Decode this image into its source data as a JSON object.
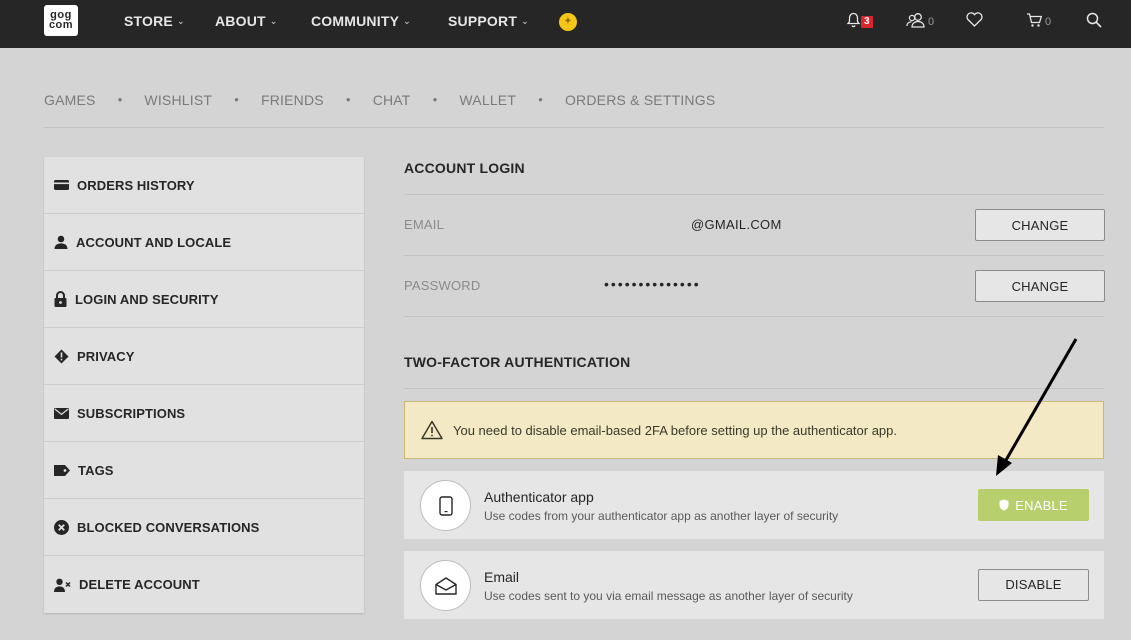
{
  "topbar": {
    "logo_line1": "gog",
    "logo_line2": "com",
    "nav": [
      {
        "label": "STORE"
      },
      {
        "label": "ABOUT"
      },
      {
        "label": "COMMUNITY"
      },
      {
        "label": "SUPPORT"
      }
    ],
    "notifications_count": "3",
    "friends_count": "0",
    "cart_count": "0"
  },
  "subnav": [
    "GAMES",
    "WISHLIST",
    "FRIENDS",
    "CHAT",
    "WALLET",
    "ORDERS & SETTINGS"
  ],
  "sidebar": [
    {
      "label": "ORDERS HISTORY",
      "icon": "card-icon"
    },
    {
      "label": "ACCOUNT AND LOCALE",
      "icon": "user-icon"
    },
    {
      "label": "LOGIN AND SECURITY",
      "icon": "lock-icon"
    },
    {
      "label": "PRIVACY",
      "icon": "privacy-icon"
    },
    {
      "label": "SUBSCRIPTIONS",
      "icon": "envelope-icon"
    },
    {
      "label": "TAGS",
      "icon": "tag-icon"
    },
    {
      "label": "BLOCKED CONVERSATIONS",
      "icon": "blocked-icon"
    },
    {
      "label": "DELETE ACCOUNT",
      "icon": "delete-user-icon"
    }
  ],
  "account_login": {
    "title": "ACCOUNT LOGIN",
    "email_label": "EMAIL",
    "email_value": "@GMAIL.COM",
    "password_label": "PASSWORD",
    "password_value": "••••••••••••••",
    "change_label": "CHANGE"
  },
  "two_factor": {
    "title": "TWO-FACTOR AUTHENTICATION",
    "warning": "You need to disable email-based 2FA before setting up the authenticator app.",
    "authenticator": {
      "title": "Authenticator app",
      "desc": "Use codes from your authenticator app as another layer of security",
      "button": "ENABLE"
    },
    "email": {
      "title": "Email",
      "desc": "Use codes sent to you via email message as another layer of security",
      "button": "DISABLE"
    }
  },
  "colors": {
    "topbar": "#262626",
    "enable_button": "#b8cf6e",
    "badge": "#d9262c",
    "warning_bg": "#f3e9c4"
  }
}
